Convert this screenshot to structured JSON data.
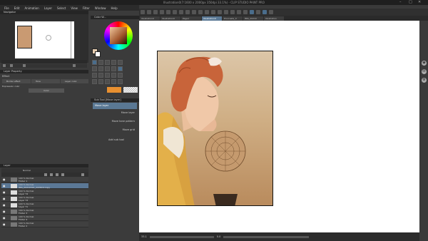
{
  "window": {
    "title": "Illustration0(7:1600 x 2000px 350dpi 33.1%) - CLIP STUDIO PAINT PRO",
    "controls": [
      "–",
      "□",
      "✕"
    ]
  },
  "menu": [
    "File",
    "Edit",
    "Animation",
    "Layer",
    "Select",
    "View",
    "Filter",
    "Window",
    "Help"
  ],
  "tabs": [
    "Illustration0",
    "Illustration0",
    "Page1",
    "Illustration0",
    "Procreate_0",
    "IMG_20210",
    "Illustration"
  ],
  "panels": {
    "navigator": "Navigator",
    "color_wheel": "Color W...",
    "layer_property": "Layer Property",
    "effect": "Effect",
    "border_effect": "Border effect",
    "tone": "Tone",
    "layer_color": "Layer color",
    "expression_color": "Expression color",
    "color_value": "Color",
    "sub_tool": "Sub Tool [Move layer]",
    "sub_tool_items": [
      {
        "label": "Move layer"
      },
      {
        "label": "Move layer"
      },
      {
        "label": "Move tone pattern"
      },
      {
        "label": "Move grid"
      }
    ],
    "add_sub_tool": "Add sub tool",
    "layer": "Layer",
    "blend_mode": "Normal"
  },
  "layers": [
    {
      "opacity": "100 % Normal",
      "name": "Folder 1"
    },
    {
      "opacity": "100 % Normal",
      "name": "IMG_20210301_222616 Copy",
      "selected": true
    },
    {
      "opacity": "100 % Normal",
      "name": "Layer 74"
    },
    {
      "opacity": "100 % Normal",
      "name": "Layer 73"
    },
    {
      "opacity": "100 % Normal",
      "name": "Layer 71"
    },
    {
      "opacity": "100 % Normal",
      "name": "Folder 3"
    },
    {
      "opacity": "100 % Normal",
      "name": "Folder 4"
    },
    {
      "opacity": "100 % Normal",
      "name": "Folder 2"
    }
  ],
  "status": {
    "zoom": "33.1",
    "angle": "0.0"
  },
  "colors": {
    "accent": "#5a7894",
    "tone_swatch": "#e89030"
  }
}
